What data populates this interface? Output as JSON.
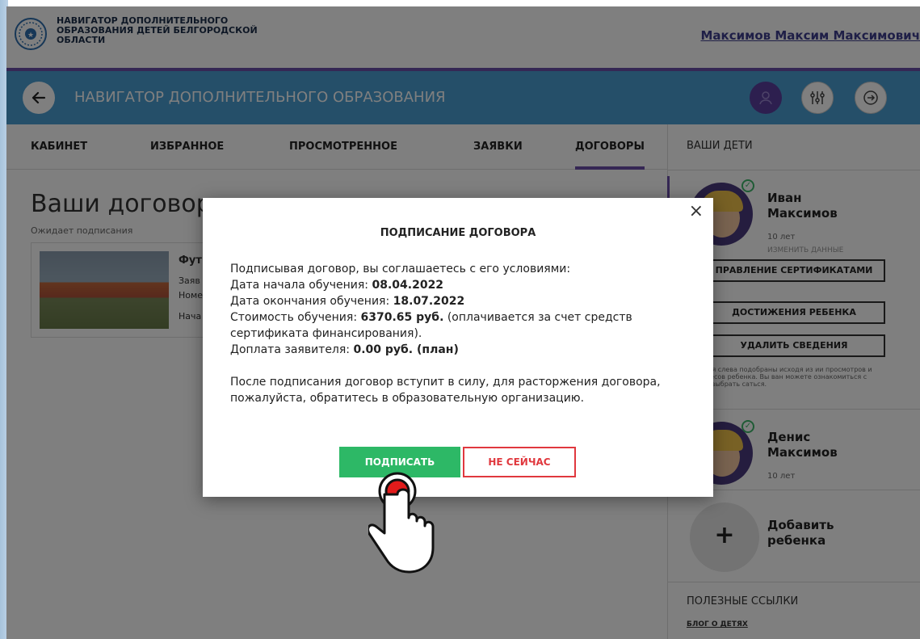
{
  "header": {
    "logo_text": "НАВИГАТОР ДОПОЛНИТЕЛЬНОГО ОБРАЗОВАНИЯ ДЕТЕЙ БЕЛГОРОДСКОЙ ОБЛАСТИ",
    "user_name": "Максимов Максим Максимович"
  },
  "navbar": {
    "title": "НАВИГАТОР ДОПОЛНИТЕЛЬНОГО ОБРАЗОВАНИЯ"
  },
  "tabs": [
    {
      "label": "КАБИНЕТ"
    },
    {
      "label": "ИЗБРАННОЕ"
    },
    {
      "label": "ПРОСМОТРЕННОЕ"
    },
    {
      "label": "ЗАЯВКИ"
    },
    {
      "label": "ДОГОВОРЫ",
      "active": true
    }
  ],
  "main": {
    "title": "Ваши договоры",
    "status_label": "Ожидает подписания",
    "card": {
      "title": "Фут",
      "line1": "Заяв",
      "line2": "Номе",
      "line3": "Нача"
    }
  },
  "sidebar": {
    "heading": "ВАШИ ДЕТИ",
    "children": [
      {
        "name": "Иван Максимов",
        "age": "10 лет",
        "edit": "ИЗМЕНИТЬ ДАННЫЕ"
      },
      {
        "name": "Денис Максимов",
        "age": "10 лет"
      }
    ],
    "buttons": [
      "ПРАВЛЕНИЕ СЕРТИФИКАТАМИ",
      "ДОСТИЖЕНИЯ РЕБЕНКА",
      "УДАЛИТЬ СВЕДЕНИЯ"
    ],
    "note": "ожения слева подобраны исходя из ии просмотров и интересов ребенка. Вы ван можете ознакомиться с ними, выбрать саться.",
    "add_child": "Добавить ребенка",
    "add_symbol": "+",
    "links_heading": "ПОЛЕЗНЫЕ ССЫЛКИ",
    "blog_link": "БЛОГ О ДЕТЯХ"
  },
  "modal": {
    "title": "ПОДПИСАНИЕ ДОГОВОРА",
    "close_symbol": "×",
    "intro": "Подписывая договор, вы соглашаетесь с его условиями:",
    "start_label": "Дата начала обучения: ",
    "start_value": "08.04.2022",
    "end_label": "Дата окончания обучения: ",
    "end_value": "18.07.2022",
    "cost_label": "Стоимость обучения: ",
    "cost_value": "6370.65 руб.",
    "cost_note": " (оплачивается за счет средств сертификата финансирования).",
    "surcharge_label": "Доплата заявителя: ",
    "surcharge_value": "0.00 руб. (план)",
    "after_text": "После подписания договор вступит в силу, для расторжения договора, пожалуйста, обратитесь в образовательную организацию.",
    "sign_button": "ПОДПИСАТЬ",
    "later_button": "НЕ СЕЙЧАС"
  },
  "colors": {
    "navbar": "#4a9ed2",
    "accent_purple": "#6b4ea8",
    "sign_green": "#2db866",
    "later_red": "#e0383e"
  },
  "icons": [
    "logo-emblem-icon",
    "back-arrow-icon",
    "user-icon",
    "filter-sliders-icon",
    "logout-icon",
    "check-icon",
    "close-icon",
    "pointing-hand-icon"
  ]
}
